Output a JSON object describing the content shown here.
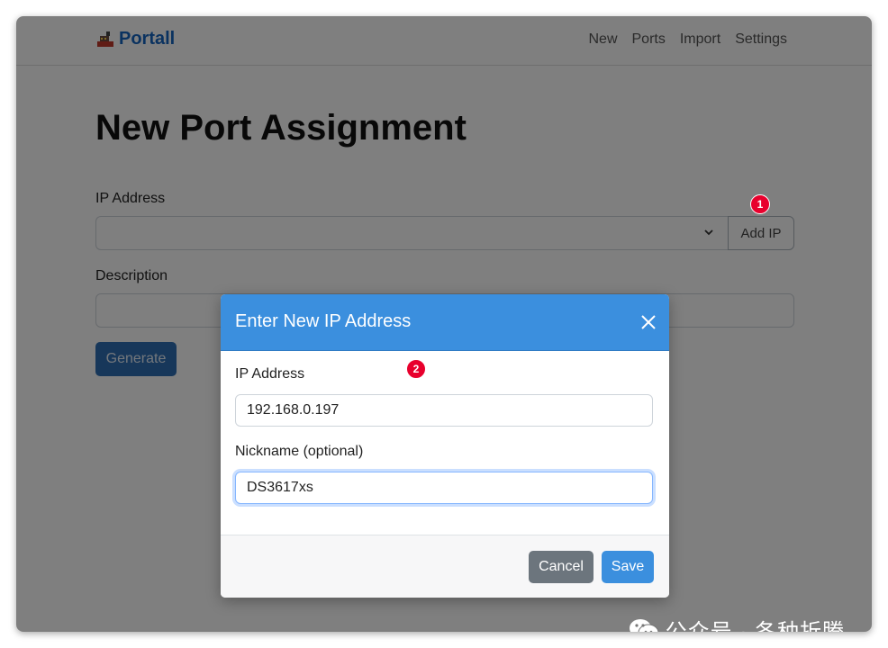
{
  "brand": {
    "name": "Portall",
    "logo_icon": "ship-icon"
  },
  "nav": {
    "items": [
      "New",
      "Ports",
      "Import",
      "Settings"
    ]
  },
  "page": {
    "title": "New Port Assignment",
    "ip_label": "IP Address",
    "ip_select_value": "",
    "add_ip_label": "Add IP",
    "description_label": "Description",
    "description_value": "",
    "generate_label": "Generate"
  },
  "modal": {
    "title": "Enter New IP Address",
    "ip_label": "IP Address",
    "ip_value": "192.168.0.197",
    "nickname_label": "Nickname (optional)",
    "nickname_value": "DS3617xs",
    "cancel_label": "Cancel",
    "save_label": "Save"
  },
  "annotations": {
    "badge1": "1",
    "badge2": "2"
  },
  "watermark": {
    "text": "公众号 · 各种折腾"
  },
  "colors": {
    "brand": "#1565c0",
    "primary": "#3b8fde",
    "secondary": "#6c757d",
    "badge": "#e8002d"
  }
}
